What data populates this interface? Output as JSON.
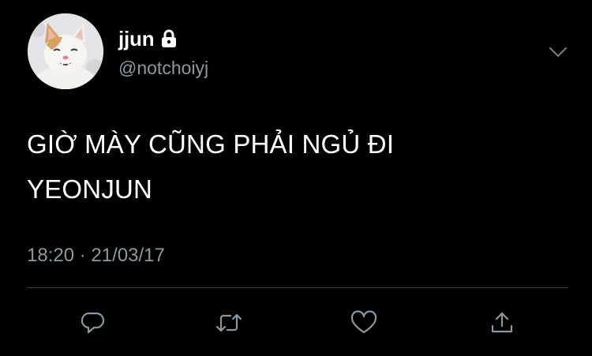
{
  "user": {
    "display_name": "jjun",
    "handle": "@notchoiyj",
    "avatar_icon": "cat-avatar-icon",
    "locked_icon": "lock-icon"
  },
  "tweet": {
    "lines": [
      "GIỜ MÀY CŨNG PHẢI NGỦ ĐI",
      "YEONJUN"
    ],
    "timestamp": "18:20 · 21/03/17"
  },
  "actions": [
    {
      "name": "reply",
      "icon": "reply-icon"
    },
    {
      "name": "retweet",
      "icon": "retweet-icon"
    },
    {
      "name": "like",
      "icon": "heart-icon"
    },
    {
      "name": "share",
      "icon": "share-icon"
    }
  ],
  "colors": {
    "background": "#000000",
    "text_primary": "#ffffff",
    "text_secondary": "#8899a6",
    "divider": "#38444d",
    "icon": "#8899a6"
  }
}
